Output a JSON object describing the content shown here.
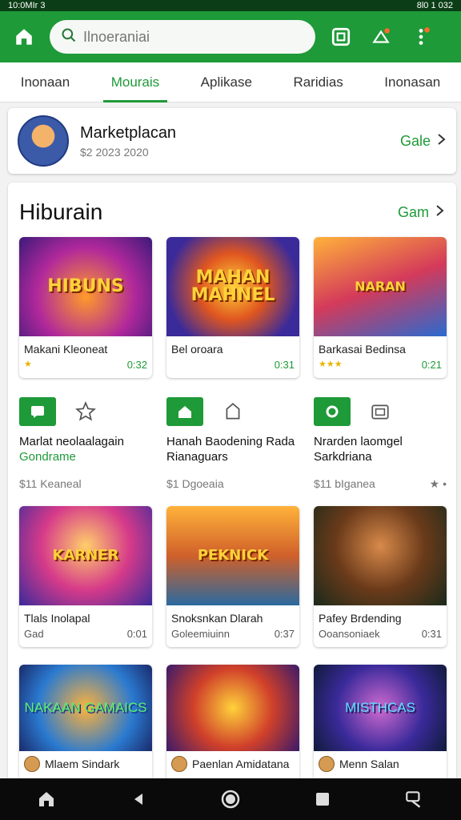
{
  "status": {
    "left": "10:0MIr 3",
    "right": "8l0 1 032"
  },
  "search": {
    "placeholder": "Ilnoeraniai"
  },
  "tabs": [
    {
      "label": "Inonaan",
      "active": false
    },
    {
      "label": "Mourais",
      "active": true
    },
    {
      "label": "Aplikase",
      "active": false
    },
    {
      "label": "Raridias",
      "active": false
    },
    {
      "label": "Inonasan",
      "active": false
    }
  ],
  "market": {
    "title": "Marketplacan",
    "sub": "$2 2023 2020",
    "link": "Gale"
  },
  "section": {
    "title": "Hiburain",
    "link": "Gam"
  },
  "row1": [
    {
      "art": "HIBUNS",
      "name": "Makani Kleoneat",
      "rating": "★",
      "price": "0:32"
    },
    {
      "art": "MAHAN MAHNEL",
      "name": "Bel oroara",
      "rating": "",
      "price": "0:31"
    },
    {
      "art": "NARAN",
      "name": "Barkasai Bedinsa",
      "rating": "★★★",
      "price": "0:21"
    }
  ],
  "info": [
    {
      "title": "Marlat neolaalagain",
      "sub": "Gondrame",
      "price": "$11 Keaneal",
      "extra": ""
    },
    {
      "title": "Hanah Baodening Rada Rianaguars",
      "sub": "",
      "price": "$1 Dgoeaia",
      "extra": ""
    },
    {
      "title": "Nrarden laomgel Sarkdriana",
      "sub": "",
      "price": "$11 bIganea",
      "extra": "★ •"
    }
  ],
  "row2": [
    {
      "art": "KARNER",
      "name": "Tlals Inolapal",
      "sub": "Gad",
      "price": "0:01"
    },
    {
      "art": "PEKNICK",
      "name": "Snoksnkan Dlarah",
      "sub": "Goleemiuinn",
      "price": "0:37"
    },
    {
      "art": "",
      "name": "Pafey Brdending",
      "sub": "Ooansoniaek",
      "price": "0:31"
    }
  ],
  "row3": [
    {
      "art": "NAKAAN GAMAICS",
      "name": "Mlaem Sindark"
    },
    {
      "art": "",
      "name": "Paenlan Amidatana"
    },
    {
      "art": "MISTHCAS",
      "name": "Menn Salan"
    }
  ]
}
